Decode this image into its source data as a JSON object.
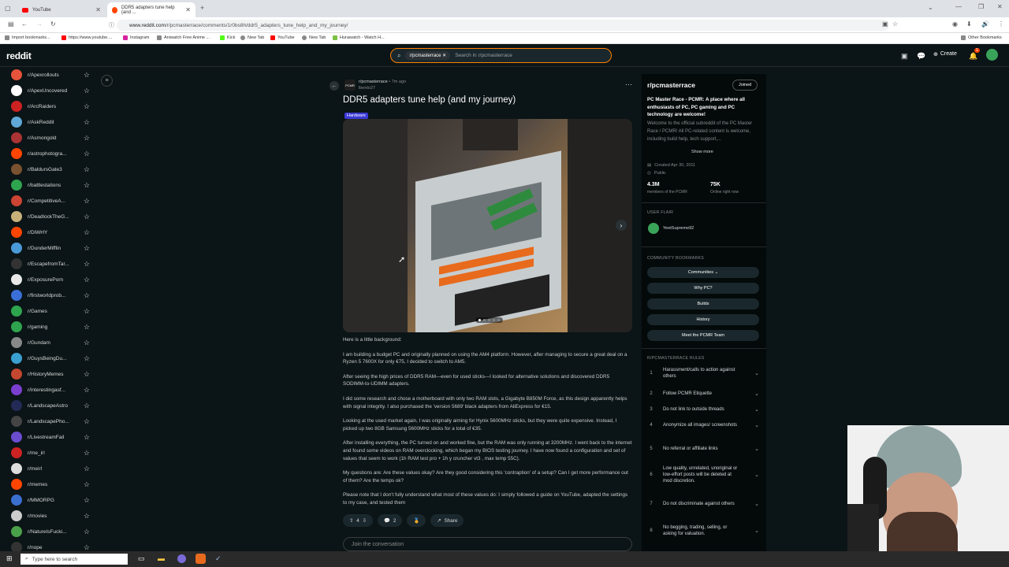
{
  "browser": {
    "tabs": [
      {
        "label": "YouTube",
        "icon": "youtube-icon"
      },
      {
        "label": "DDR5 adapters tune help (and ...",
        "icon": "reddit-icon"
      }
    ],
    "url_host": "www.reddit.com",
    "url_path": "/r/pcmasterrace/comments/1r0bs8h/ddr5_adapters_tune_help_and_my_journey/",
    "bookmarks": [
      "Import bookmarks...",
      "https://www.youtube....",
      "Instagram",
      "Aniwatch Free Anime ...",
      "Kick",
      "New Tab",
      "YouTube",
      "New Tab",
      "Hurawatch - Watch H..."
    ],
    "other_bookmarks": "Other Bookmarks"
  },
  "header": {
    "logo": "reddit",
    "search_chip": "r/pcmasterrace",
    "search_placeholder": "Search in r/pcmasterrace",
    "create_label": "Create",
    "notif_count": "1",
    "accent": "#ff4500"
  },
  "sidebar": {
    "items": [
      {
        "label": "r/Apexrollouts",
        "color": "#e5533b"
      },
      {
        "label": "r/ApexUncovered",
        "color": "#ffffff"
      },
      {
        "label": "r/ArcRaiders",
        "color": "#cc2222"
      },
      {
        "label": "r/AskReddit",
        "color": "#5fa8d8"
      },
      {
        "label": "r/Asmongold",
        "color": "#a33"
      },
      {
        "label": "r/astrophotogra...",
        "color": "#ff4500"
      },
      {
        "label": "r/BaldursGate3",
        "color": "#7a5230"
      },
      {
        "label": "r/battlestations",
        "color": "#2ea44f"
      },
      {
        "label": "r/CompetitiveA...",
        "color": "#c43"
      },
      {
        "label": "r/DeadlockTheG...",
        "color": "#c8b07a"
      },
      {
        "label": "r/DiWHY",
        "color": "#ff4500"
      },
      {
        "label": "r/DunderMifflin",
        "color": "#4a9ad8"
      },
      {
        "label": "r/EscapefromTar...",
        "color": "#333333"
      },
      {
        "label": "r/ExposurePorn",
        "color": "#e8e8e8"
      },
      {
        "label": "r/firstworldprob...",
        "color": "#3b6fd8"
      },
      {
        "label": "r/Games",
        "color": "#2ea44f"
      },
      {
        "label": "r/gaming",
        "color": "#2ea44f"
      },
      {
        "label": "r/Gundam",
        "color": "#888888"
      },
      {
        "label": "r/GuysBeingDu...",
        "color": "#3aa0d0"
      },
      {
        "label": "r/HistoryMemes",
        "color": "#c4472f"
      },
      {
        "label": "r/interestingasf...",
        "color": "#7b3fd0"
      },
      {
        "label": "r/LandscapeAstro",
        "color": "#222a55"
      },
      {
        "label": "r/LandscapePho...",
        "color": "#444444"
      },
      {
        "label": "r/LivestreamFail",
        "color": "#6a4ccf"
      },
      {
        "label": "r/me_irl",
        "color": "#cc2222"
      },
      {
        "label": "r/meirl",
        "color": "#dddddd"
      },
      {
        "label": "r/memes",
        "color": "#ff4500"
      },
      {
        "label": "r/MMORPG",
        "color": "#3a6fd0"
      },
      {
        "label": "r/movies",
        "color": "#cccccc"
      },
      {
        "label": "r/NatureIsFucki...",
        "color": "#4aa04a"
      },
      {
        "label": "r/nope",
        "color": "#333333"
      }
    ]
  },
  "post": {
    "subreddit": "r/pcmasterrace",
    "age": "7m ago",
    "author": "lbento27",
    "title": "DDR5 adapters tune help (and my journey)",
    "flair": "Hardware",
    "body": [
      "Here is a little background:",
      "I am building a budget PC and originally planned on using the AM4 platform. However, after managing to secure a great deal on a Ryzen 5 7600X for only €75, I decided to switch to AM5.",
      "After seeing the high prices of DDR5 RAM—even for used sticks—I looked for alternative solutions and discovered DDR5 SODIMM-to-UDIMM adapters.",
      "I did some research and chose a motherboard with only two RAM slots, a Gigabyte B850M Force, as this design apparently helps with signal integrity. I also purchased the 'version 5689' black adapters from AliExpress for €15.",
      "Looking at the used market again, I was originally aiming for Hynix 5600MHz sticks, but they were quite expensive. Instead, I picked up two 8GB Samsung 5600MHz sticks for a total of €35.",
      "After installing everything, the PC turned on and worked fine, but the RAM was only running at 3200MHz. I went back to the internet and found some videos on RAM overclocking, which began my BIOS testing journey. I have now found a configuration and set of values that seem to work (1h RAM test pro + 1h y cruncher vt3 , max temp 55C).",
      "My questions are: Are these values okay? Are they good considering this 'contraption' of a setup? Can I get more performance out of them? Are the temps ok?",
      "Please note that I don't fully understand what most of these values do: I simply followed a guide on YouTube, adapted the settings to my case, and tested them"
    ],
    "votes": "4",
    "comments": "2",
    "share_label": "Share",
    "join_placeholder": "Join the conversation"
  },
  "community": {
    "name": "r/pcmasterrace",
    "joined_label": "Joined",
    "headline": "PC Master Race - PCMR: A place where all enthusiasts of PC, PC gaming and PC technology are welcome!",
    "description": "Welcome to the official subreddit of the PC Master Race / PCMR! All PC-related content is welcome, including build help, tech support,...",
    "show_more": "Show more",
    "created": "Created Apr 30, 2011",
    "visibility": "Public",
    "members": "4.3M",
    "members_label": "members of the PCMR",
    "online": "75K",
    "online_label": "Online right now",
    "user_flair_title": "USER FLAIR",
    "user_flair_name": "YeetSupreme92",
    "bookmarks_title": "COMMUNITY BOOKMARKS",
    "bookmarks": [
      "Communities",
      "Why PC?",
      "Builds",
      "History",
      "Meet the PCMR Team"
    ],
    "rules_title": "R/PCMASTERRACE RULES",
    "rules": [
      {
        "n": "1",
        "text": "Harassment/calls to action against others"
      },
      {
        "n": "2",
        "text": "Follow PCMR Etiquette"
      },
      {
        "n": "3",
        "text": "Do not link to outside threads"
      },
      {
        "n": "4",
        "text": "Anonymize all images/ screenshots"
      },
      {
        "n": "5",
        "text": "No referral or affiliate links"
      },
      {
        "n": "6",
        "text": "Low quality, unrelated, unoriginal or low-effort posts will be deleted at mod discretion."
      },
      {
        "n": "7",
        "text": "Do not discriminate against others"
      },
      {
        "n": "8",
        "text": "No begging, trading, selling, or asking for valuation."
      }
    ]
  },
  "taskbar": {
    "search_placeholder": "Type here to search"
  }
}
